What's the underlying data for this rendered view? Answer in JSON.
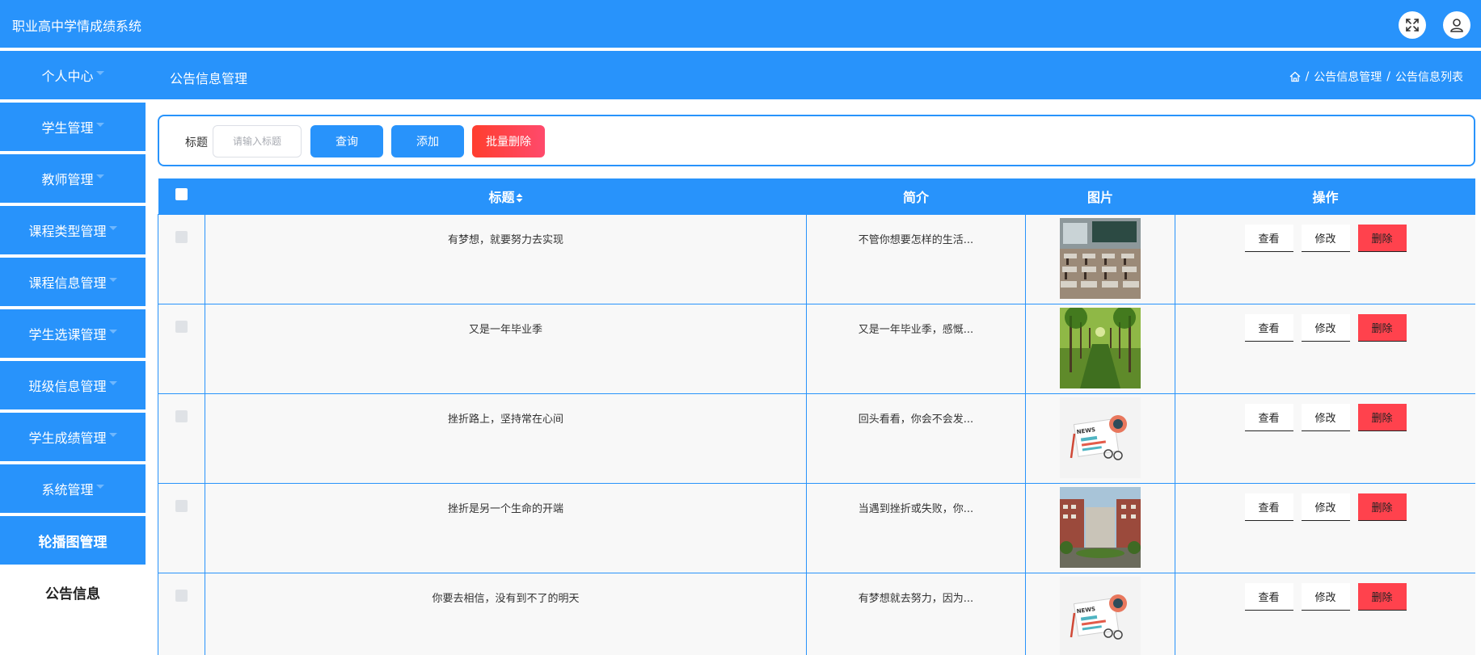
{
  "app": {
    "title": "职业高中学情成绩系统"
  },
  "sidebar": {
    "items": [
      {
        "label": "个人中心",
        "has_caret": true
      },
      {
        "label": "学生管理",
        "has_caret": true
      },
      {
        "label": "教师管理",
        "has_caret": true
      },
      {
        "label": "课程类型管理",
        "has_caret": true
      },
      {
        "label": "课程信息管理",
        "has_caret": true
      },
      {
        "label": "学生选课管理",
        "has_caret": true
      },
      {
        "label": "班级信息管理",
        "has_caret": true
      },
      {
        "label": "学生成绩管理",
        "has_caret": true
      },
      {
        "label": "系统管理",
        "has_caret": true
      },
      {
        "label": "轮播图管理",
        "has_caret": false
      },
      {
        "label": "公告信息",
        "has_caret": false,
        "active": true
      }
    ]
  },
  "page": {
    "title": "公告信息管理",
    "breadcrumb": [
      "公告信息管理",
      "公告信息列表"
    ],
    "breadcrumb_sep": "/"
  },
  "search": {
    "label": "标题",
    "placeholder": "请输入标题",
    "query_label": "查询",
    "add_label": "添加",
    "batch_delete_label": "批量删除"
  },
  "table": {
    "headers": {
      "title": "标题",
      "intro": "简介",
      "image": "图片",
      "actions": "操作"
    },
    "rows": [
      {
        "title": "有梦想，就要努力去实现",
        "intro": "不管你想要怎样的生活...",
        "image": "classroom-photo"
      },
      {
        "title": "又是一年毕业季",
        "intro": "又是一年毕业季，感慨...",
        "image": "tree-lined-path-photo"
      },
      {
        "title": "挫折路上，坚持常在心间",
        "intro": "回头看看，你会不会发...",
        "image": "news-illustration"
      },
      {
        "title": "挫折是另一个生命的开端",
        "intro": "当遇到挫折或失败，你...",
        "image": "campus-building-photo"
      },
      {
        "title": "你要去相信，没有到不了的明天",
        "intro": "有梦想就去努力，因为...",
        "image": "news-illustration"
      }
    ],
    "action_labels": {
      "view": "查看",
      "edit": "修改",
      "delete": "删除"
    }
  },
  "colors": {
    "primary": "#2893fb",
    "danger": "#ff424d"
  }
}
